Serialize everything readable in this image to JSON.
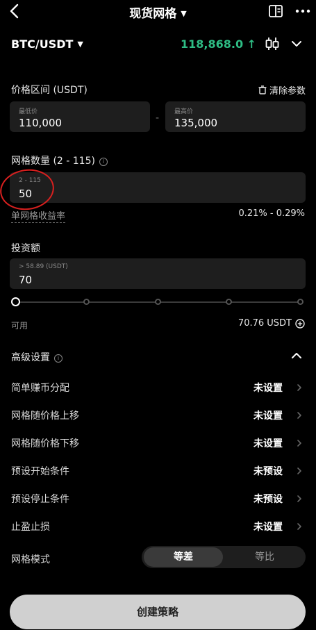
{
  "header": {
    "title": "现货网格",
    "back_icon": "chevron-left-icon",
    "book_icon": "book-icon",
    "more_icon": "more-dots-icon"
  },
  "pair": {
    "symbol": "BTC/USDT",
    "price": "118,868.0",
    "price_arrow": "↑",
    "price_color": "#2ebd85"
  },
  "price_range": {
    "label": "价格区间 (USDT)",
    "clear_label": "清除参数",
    "low": {
      "placeholder": "最低价",
      "value": "110,000"
    },
    "separator": "-",
    "high": {
      "placeholder": "最高价",
      "value": "135,000"
    }
  },
  "grid_count": {
    "label": "网格数量 (2 - 115)",
    "placeholder": "2 - 115",
    "value": "50",
    "yield_label": "单网格收益率",
    "yield_value": "0.21% - 0.29%"
  },
  "investment": {
    "label": "投资额",
    "placeholder": "> 58.89 (USDT)",
    "value": "70",
    "slider_value": 0,
    "available_label": "可用",
    "available_value": "70.76 USDT"
  },
  "advanced": {
    "label": "高级设置",
    "rows": [
      {
        "label": "简单赚币分配",
        "value": "未设置"
      },
      {
        "label": "网格随价格上移",
        "value": "未设置"
      },
      {
        "label": "网格随价格下移",
        "value": "未设置"
      },
      {
        "label": "预设开始条件",
        "value": "未预设"
      },
      {
        "label": "预设停止条件",
        "value": "未预设"
      },
      {
        "label": "止盈止损",
        "value": "未设置"
      }
    ]
  },
  "grid_mode": {
    "label": "网格模式",
    "options": [
      "等差",
      "等比"
    ],
    "selected": "等差"
  },
  "create_button": "创建策略"
}
